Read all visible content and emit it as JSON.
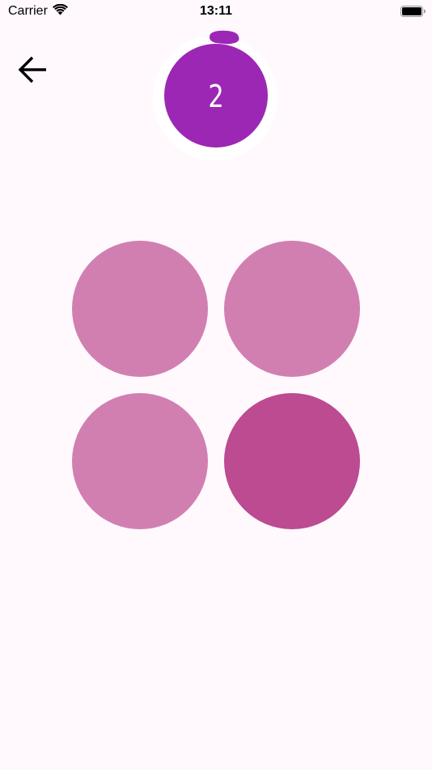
{
  "status_bar": {
    "carrier": "Carrier",
    "time": "13:11",
    "wifi_icon": "wifi-icon",
    "battery_icon": "battery-full-icon"
  },
  "nav": {
    "back_icon": "arrow-left-icon"
  },
  "timer": {
    "count": "2",
    "color": "#9c27b5"
  },
  "bubbles": [
    {
      "color": "#d17fb1",
      "highlighted": false
    },
    {
      "color": "#d17fb1",
      "highlighted": false
    },
    {
      "color": "#d17fb1",
      "highlighted": false
    },
    {
      "color": "#bc4b92",
      "highlighted": true
    }
  ],
  "colors": {
    "background": "#fff9fe",
    "bubble_normal": "#d17fb1",
    "bubble_highlight": "#bc4b92"
  }
}
